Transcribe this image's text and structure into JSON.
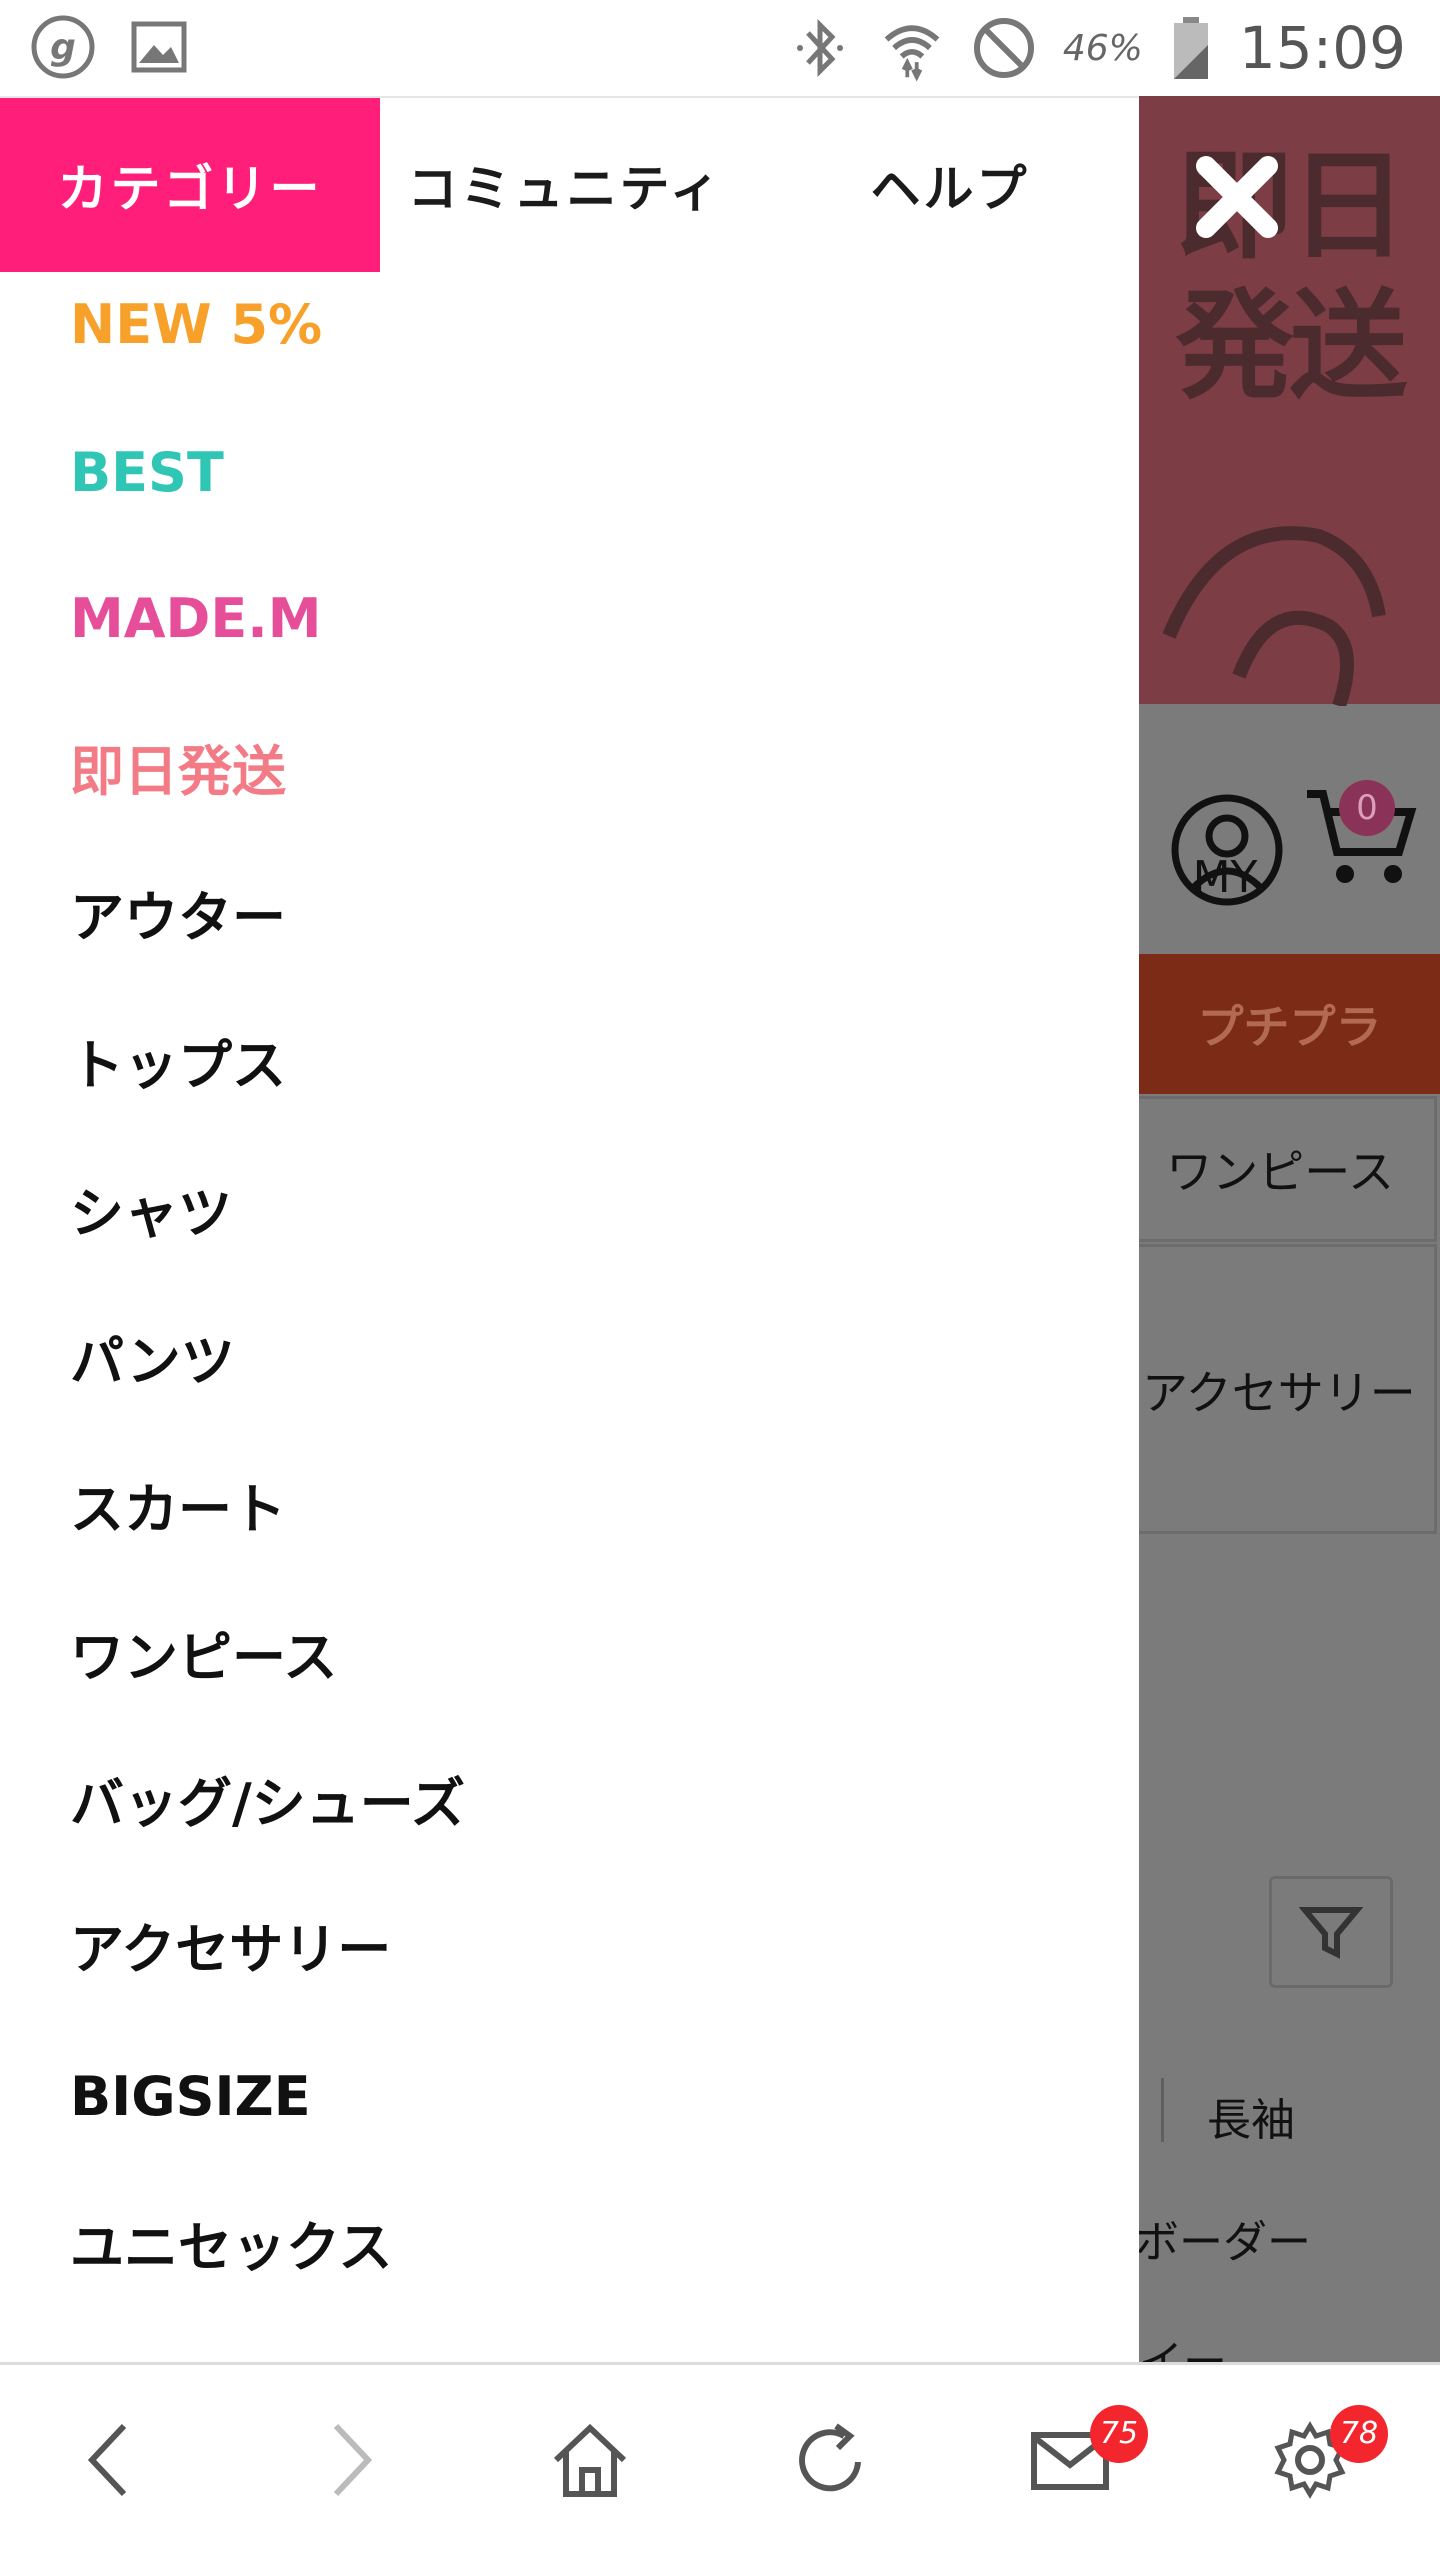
{
  "status_bar": {
    "battery_percent": "46%",
    "time": "15:09",
    "icons": [
      "g-app-icon",
      "gallery-icon",
      "bluetooth-icon",
      "wifi-icon",
      "do-not-disturb-icon",
      "battery-icon"
    ]
  },
  "drawer": {
    "tabs": [
      {
        "label": "カテゴリー",
        "active": true
      },
      {
        "label": "コミュニティ",
        "active": false
      },
      {
        "label": "ヘルプ",
        "active": false
      }
    ],
    "active_tab_color": "#ff1e79",
    "menu_items": [
      {
        "label": "NEW 5%",
        "color": "#f7a12a"
      },
      {
        "label": "BEST",
        "color": "#2fc6b6"
      },
      {
        "label": "MADE.M",
        "color": "#e64e9a"
      },
      {
        "label": "即日発送",
        "color": "#f27b86"
      },
      {
        "label": "アウター",
        "color": "#111111"
      },
      {
        "label": "トップス",
        "color": "#111111"
      },
      {
        "label": "シャツ",
        "color": "#111111"
      },
      {
        "label": "パンツ",
        "color": "#111111"
      },
      {
        "label": "スカート",
        "color": "#111111"
      },
      {
        "label": "ワンピース",
        "color": "#111111"
      },
      {
        "label": "バッグ/シューズ",
        "color": "#111111"
      },
      {
        "label": "アクセサリー",
        "color": "#111111"
      },
      {
        "label": "BIGSIZE",
        "color": "#111111"
      },
      {
        "label": "ユニセックス",
        "color": "#111111"
      }
    ]
  },
  "background_page": {
    "banner_text": "即日\n発送",
    "my_label": "MY",
    "cart_count": "0",
    "tab_label": "プチプラ",
    "category_1": "ワンピース",
    "category_2": "アクセサリー",
    "filter_text_1": "長袖",
    "filter_text_2": "ボーダー",
    "filter_text_3": "イー"
  },
  "bottom_bar": {
    "mail_badge": "75",
    "settings_badge": "78"
  }
}
